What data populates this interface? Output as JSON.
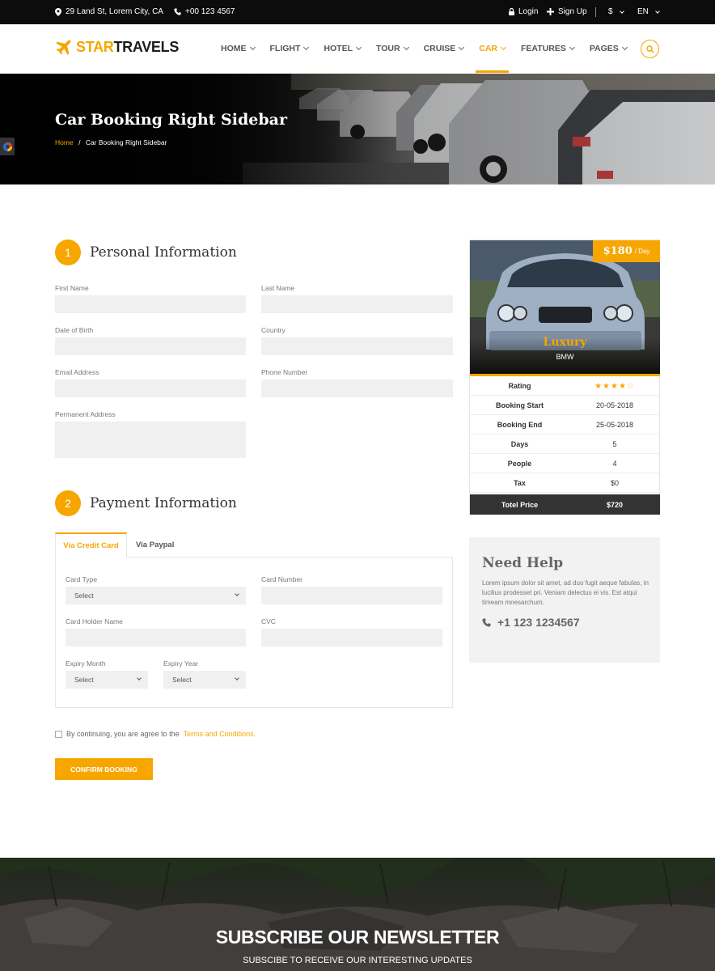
{
  "topbar": {
    "address": "29 Land St, Lorem City, CA",
    "phone": "+00 123 4567",
    "login": "Login",
    "signup": "Sign Up",
    "currency": "$",
    "language": "EN"
  },
  "header": {
    "logo_star": "STAR",
    "logo_travels": "TRAVELS",
    "nav": [
      {
        "label": "HOME"
      },
      {
        "label": "FLIGHT"
      },
      {
        "label": "HOTEL"
      },
      {
        "label": "TOUR"
      },
      {
        "label": "CRUISE"
      },
      {
        "label": "CAR"
      },
      {
        "label": "FEATURES"
      },
      {
        "label": "PAGES"
      }
    ],
    "active_nav": "CAR"
  },
  "hero": {
    "title": "Car Booking Right Sidebar",
    "breadcrumb_home": "Home",
    "breadcrumb_sep": "/",
    "breadcrumb_current": "Car Booking Right Sidebar"
  },
  "personal": {
    "step": "1",
    "title": "Personal Information",
    "first_name": "First Name",
    "last_name": "Last Name",
    "dob": "Date of Birth",
    "country": "Country",
    "email": "Email Address",
    "phone": "Phone Number",
    "address": "Permanent Address"
  },
  "payment": {
    "step": "2",
    "title": "Payment Information",
    "tab_card": "Via Credit Card",
    "tab_paypal": "Via Paypal",
    "card_type": "Card Type",
    "card_type_value": "Select",
    "card_number": "Card Number",
    "holder": "Card Holder Name",
    "cvc": "CVC",
    "expiry_month": "Expiry Month",
    "expiry_month_value": "Select",
    "expiry_year": "Expiry Year",
    "expiry_year_value": "Select"
  },
  "agree": {
    "text": "By continuing, you are agree to the",
    "link": "Terms and Conditions."
  },
  "confirm_label": "CONFIRM BOOKING",
  "car": {
    "price": "$180",
    "per": "/ Day",
    "name": "Luxury",
    "brand": "BMW",
    "rating_label": "Rating",
    "rating_value": 4,
    "rating_max": 5,
    "rows": [
      {
        "k": "Booking Start",
        "v": "20-05-2018"
      },
      {
        "k": "Booking End",
        "v": "25-05-2018"
      },
      {
        "k": "Days",
        "v": "5"
      },
      {
        "k": "People",
        "v": "4"
      },
      {
        "k": "Tax",
        "v": "$0"
      }
    ],
    "total_label": "Totel Price",
    "total_value": "$720"
  },
  "help": {
    "title": "Need Help",
    "text": "Lorem ipsum dolor sit amet, ad duo fugit aeque fabulas, in lucilius prodesset pri. Veniam delectus ei vis. Est atqui timeam mnesarchum.",
    "phone": "+1 123 1234567"
  },
  "newsletter": {
    "title": "SUBSCRIBE OUR NEWSLETTER",
    "subtitle": "SUBSCIBE TO RECEIVE OUR INTERESTING UPDATES"
  },
  "colors": {
    "accent": "#f7a600",
    "dark": "#333333",
    "topbar": "#0c0c0c"
  }
}
